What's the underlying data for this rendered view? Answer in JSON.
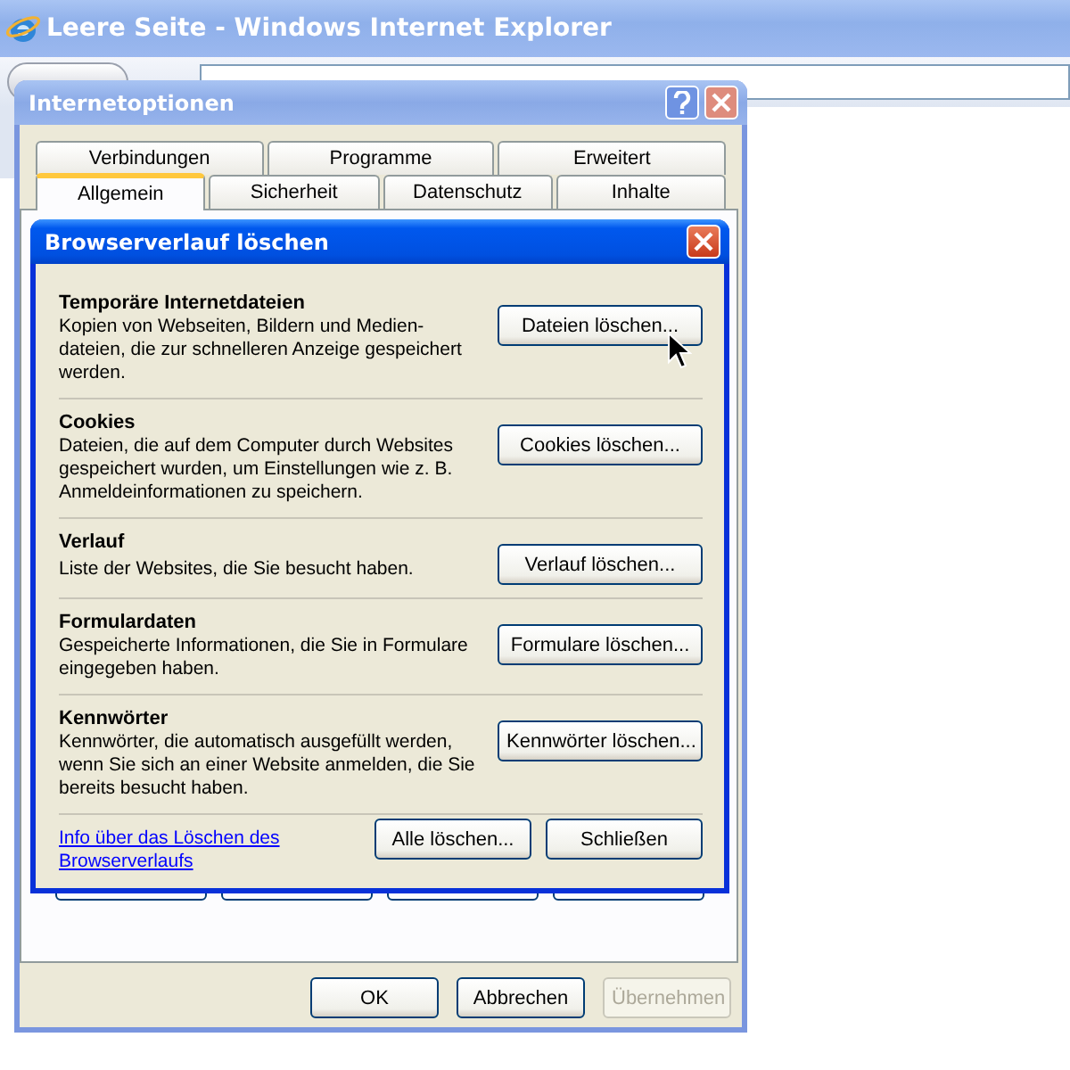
{
  "browser_window": {
    "title": "Leere Seite - Windows Internet Explorer"
  },
  "options_dialog": {
    "title": "Internetoptionen",
    "tab_rows": [
      [
        {
          "label": "Verbindungen",
          "selected": false
        },
        {
          "label": "Programme",
          "selected": false
        },
        {
          "label": "Erweitert",
          "selected": false
        }
      ],
      [
        {
          "label": "Allgemein",
          "selected": true
        },
        {
          "label": "Sicherheit",
          "selected": false
        },
        {
          "label": "Datenschutz",
          "selected": false
        },
        {
          "label": "Inhalte",
          "selected": false
        }
      ]
    ],
    "buttons": [
      {
        "label": "OK",
        "disabled": false
      },
      {
        "label": "Abbrechen",
        "disabled": false
      },
      {
        "label": "Übernehmen",
        "disabled": true
      }
    ]
  },
  "delete_dialog": {
    "title": "Browserverlauf löschen",
    "sections": [
      {
        "heading": "Temporäre Internetdateien",
        "description": "Kopien von Webseiten, Bildern und Medien-dateien, die zur schnelleren Anzeige gespeichert werden.",
        "button": "Dateien löschen..."
      },
      {
        "heading": "Cookies",
        "description": "Dateien, die auf dem Computer durch Websites gespeichert wurden, um Einstellungen wie z. B. Anmeldeinformationen zu speichern.",
        "button": "Cookies löschen..."
      },
      {
        "heading": "Verlauf",
        "description": "Liste der Websites, die Sie besucht haben.",
        "button": "Verlauf löschen..."
      },
      {
        "heading": "Formulardaten",
        "description": "Gespeicherte Informationen, die Sie in Formulare eingegeben haben.",
        "button": "Formulare löschen..."
      },
      {
        "heading": "Kennwörter",
        "description": "Kennwörter, die automatisch ausgefüllt werden, wenn Sie sich an einer Website anmelden, die Sie bereits besucht haben.",
        "button": "Kennwörter löschen..."
      }
    ],
    "link": "Info über das Löschen des Browserverlaufs",
    "buttons": [
      "Alle löschen...",
      "Schließen"
    ]
  }
}
